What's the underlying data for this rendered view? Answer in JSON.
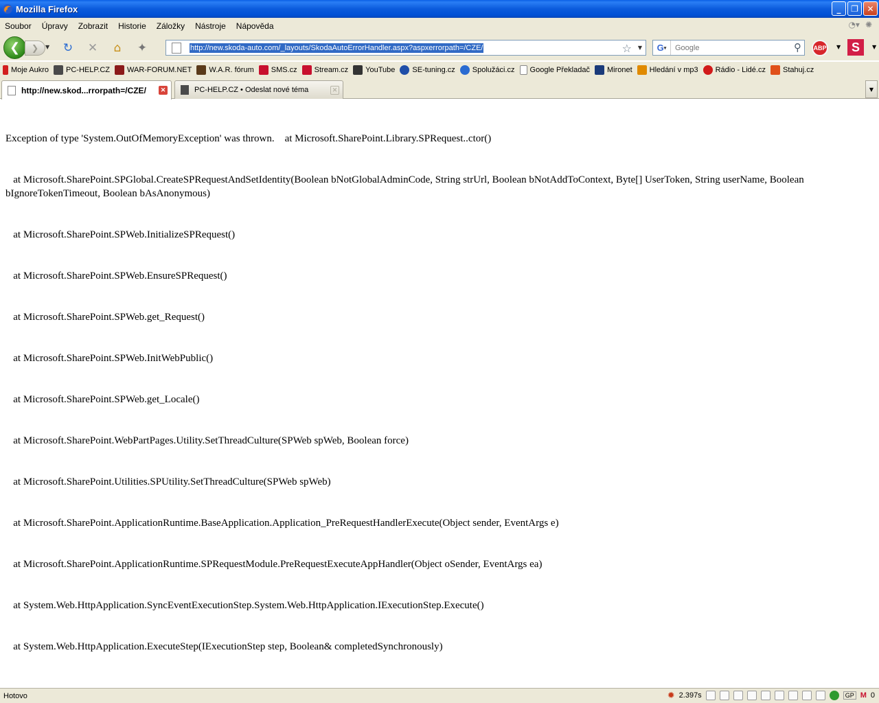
{
  "window": {
    "title": "Mozilla Firefox"
  },
  "menu": [
    "Soubor",
    "Úpravy",
    "Zobrazit",
    "Historie",
    "Záložky",
    "Nástroje",
    "Nápověda"
  ],
  "navigation": {
    "url": "http://new.skoda-auto.com/_layouts/SkodaAutoErrorHandler.aspx?aspxerrorpath=/CZE/",
    "search_placeholder": "Google",
    "search_engine_icon": "google-icon",
    "adblock_label": "ABP",
    "addon_label": "S"
  },
  "bookmarks": [
    {
      "label": "Moje Aukro",
      "icon": "aukro-icon",
      "color": "#d21f1f"
    },
    {
      "label": "PC-HELP.CZ",
      "icon": "computer-icon",
      "color": "#4a4a4a"
    },
    {
      "label": "WAR-FORUM.NET",
      "icon": "war-forum-icon",
      "color": "#8b1a1a"
    },
    {
      "label": "W.A.R. fórum",
      "icon": "war-icon",
      "color": "#5a3a1a"
    },
    {
      "label": "SMS.cz",
      "icon": "sms-icon",
      "color": "#c8102e"
    },
    {
      "label": "Stream.cz",
      "icon": "stream-icon",
      "color": "#c8102e"
    },
    {
      "label": "YouTube",
      "icon": "youtube-icon",
      "color": "#333333"
    },
    {
      "label": "SE-tuning.cz",
      "icon": "se-tuning-icon",
      "color": "#1f4ea8"
    },
    {
      "label": "Spolužáci.cz",
      "icon": "spoluzaci-icon",
      "color": "#2a6bd1"
    },
    {
      "label": "Google Překladač",
      "icon": "page-icon",
      "color": "#ffffff"
    },
    {
      "label": "Mironet",
      "icon": "mironet-icon",
      "color": "#1a3a7a"
    },
    {
      "label": "Hledání v mp3",
      "icon": "mp3-icon",
      "color": "#e08a00"
    },
    {
      "label": "Rádio - Lidé.cz",
      "icon": "radio-icon",
      "color": "#d11a1a"
    },
    {
      "label": "Stahuj.cz",
      "icon": "stahuj-icon",
      "color": "#e0501a"
    }
  ],
  "tabs": [
    {
      "label": "http://new.skod...rrorpath=/CZE/",
      "active": true
    },
    {
      "label": "PC-HELP.CZ • Odeslat nové téma",
      "active": false
    }
  ],
  "content": {
    "error_lines": [
      "Exception of type 'System.OutOfMemoryException' was thrown.    at Microsoft.SharePoint.Library.SPRequest..ctor()",
      "   at Microsoft.SharePoint.SPGlobal.CreateSPRequestAndSetIdentity(Boolean bNotGlobalAdminCode, String strUrl, Boolean bNotAddToContext, Byte[] UserToken, String userName, Boolean bIgnoreTokenTimeout, Boolean bAsAnonymous)",
      "   at Microsoft.SharePoint.SPWeb.InitializeSPRequest()",
      "   at Microsoft.SharePoint.SPWeb.EnsureSPRequest()",
      "   at Microsoft.SharePoint.SPWeb.get_Request()",
      "   at Microsoft.SharePoint.SPWeb.InitWebPublic()",
      "   at Microsoft.SharePoint.SPWeb.get_Locale()",
      "   at Microsoft.SharePoint.WebPartPages.Utility.SetThreadCulture(SPWeb spWeb, Boolean force)",
      "   at Microsoft.SharePoint.Utilities.SPUtility.SetThreadCulture(SPWeb spWeb)",
      "   at Microsoft.SharePoint.ApplicationRuntime.BaseApplication.Application_PreRequestHandlerExecute(Object sender, EventArgs e)",
      "   at Microsoft.SharePoint.ApplicationRuntime.SPRequestModule.PreRequestExecuteAppHandler(Object oSender, EventArgs ea)",
      "   at System.Web.HttpApplication.SyncEventExecutionStep.System.Web.HttpApplication.IExecutionStep.Execute()",
      "   at System.Web.HttpApplication.ExecuteStep(IExecutionStep step, Boolean& completedSynchronously)"
    ]
  },
  "status": {
    "text": "Hotovo",
    "load_time": "2.397s",
    "gp_label": "GP",
    "gmail_count": "0"
  }
}
